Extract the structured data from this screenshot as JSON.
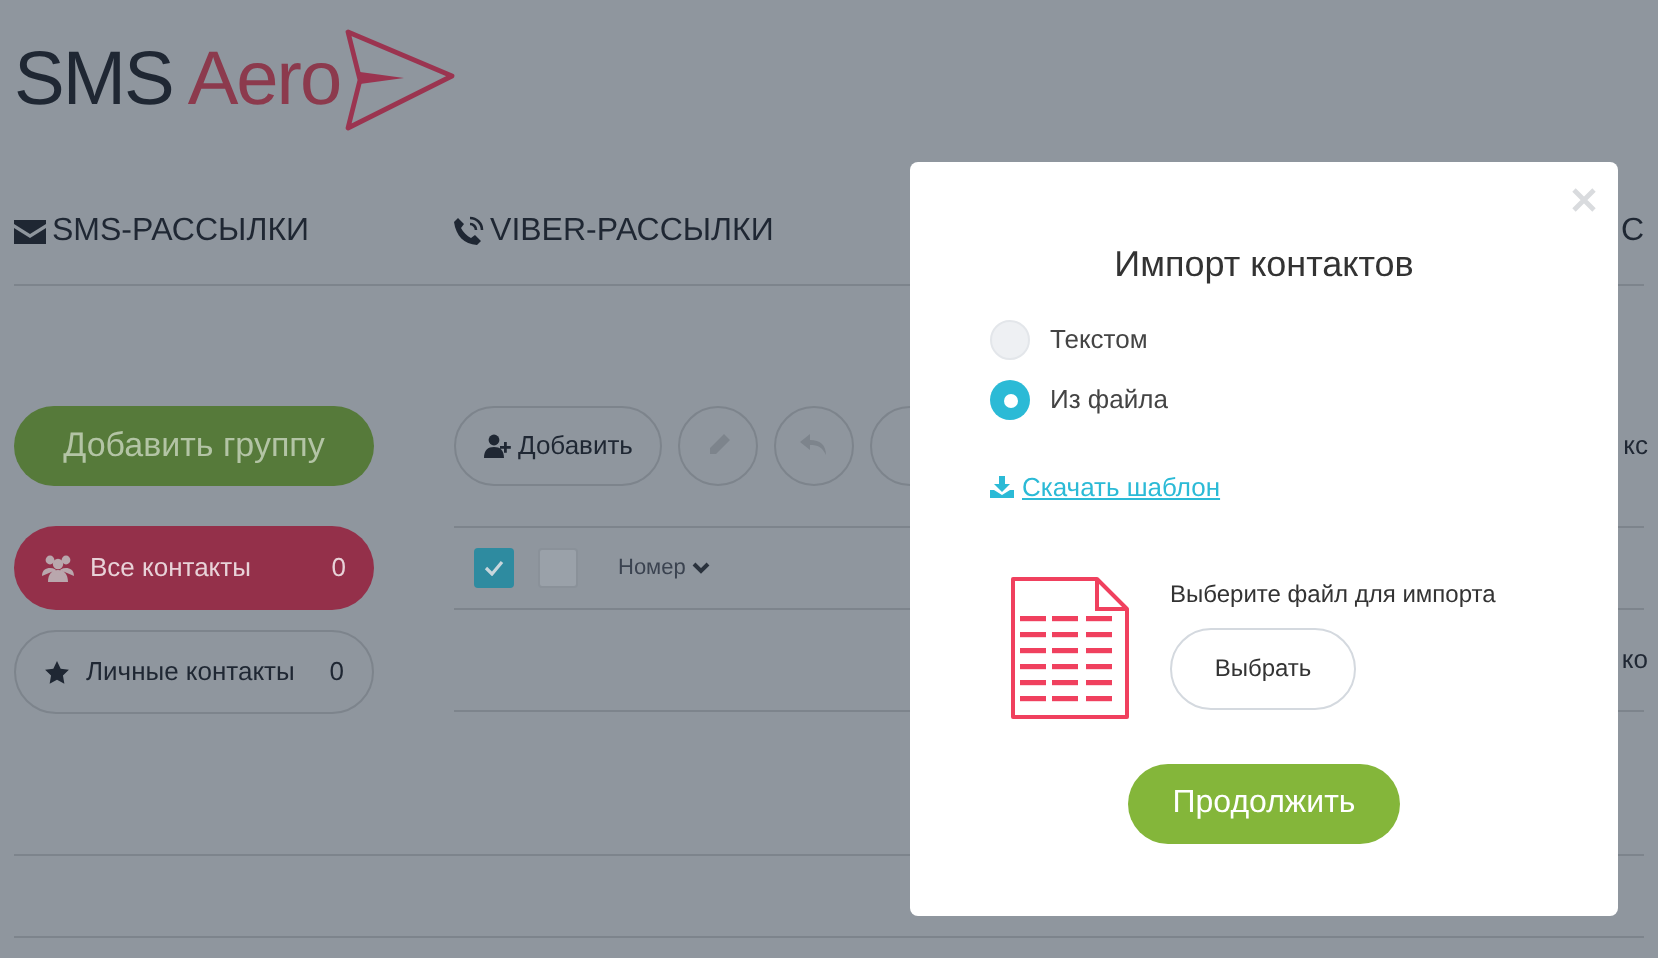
{
  "logo": {
    "part_1": "SMS",
    "part_2": "Aero"
  },
  "nav": [
    {
      "label": "SMS-РАССЫЛКИ",
      "kind": "mail"
    },
    {
      "label": "VIBER-РАССЫЛКИ",
      "kind": "phone"
    },
    {
      "label": "С",
      "kind": "partial"
    }
  ],
  "sidebar": {
    "add_group": "Добавить группу",
    "groups": [
      {
        "label": "Все контакты",
        "count": "0",
        "selected": true,
        "kind": "people"
      },
      {
        "label": "Личные контакты",
        "count": "0",
        "selected": false,
        "kind": "star"
      }
    ]
  },
  "toolbar": {
    "add": "Добавить",
    "partial_right": "кс"
  },
  "table": {
    "header_checked": true,
    "row_checked": false,
    "column_1": "Номер",
    "partial_right": "ко"
  },
  "modal": {
    "title": "Импорт контактов",
    "options": [
      {
        "label": "Текстом",
        "selected": false
      },
      {
        "label": "Из файла",
        "selected": true
      }
    ],
    "template_link": "Скачать шаблон",
    "file_prompt": "Выберите файл для импорта",
    "choose_button": "Выбрать",
    "continue_button": "Продолжить"
  }
}
